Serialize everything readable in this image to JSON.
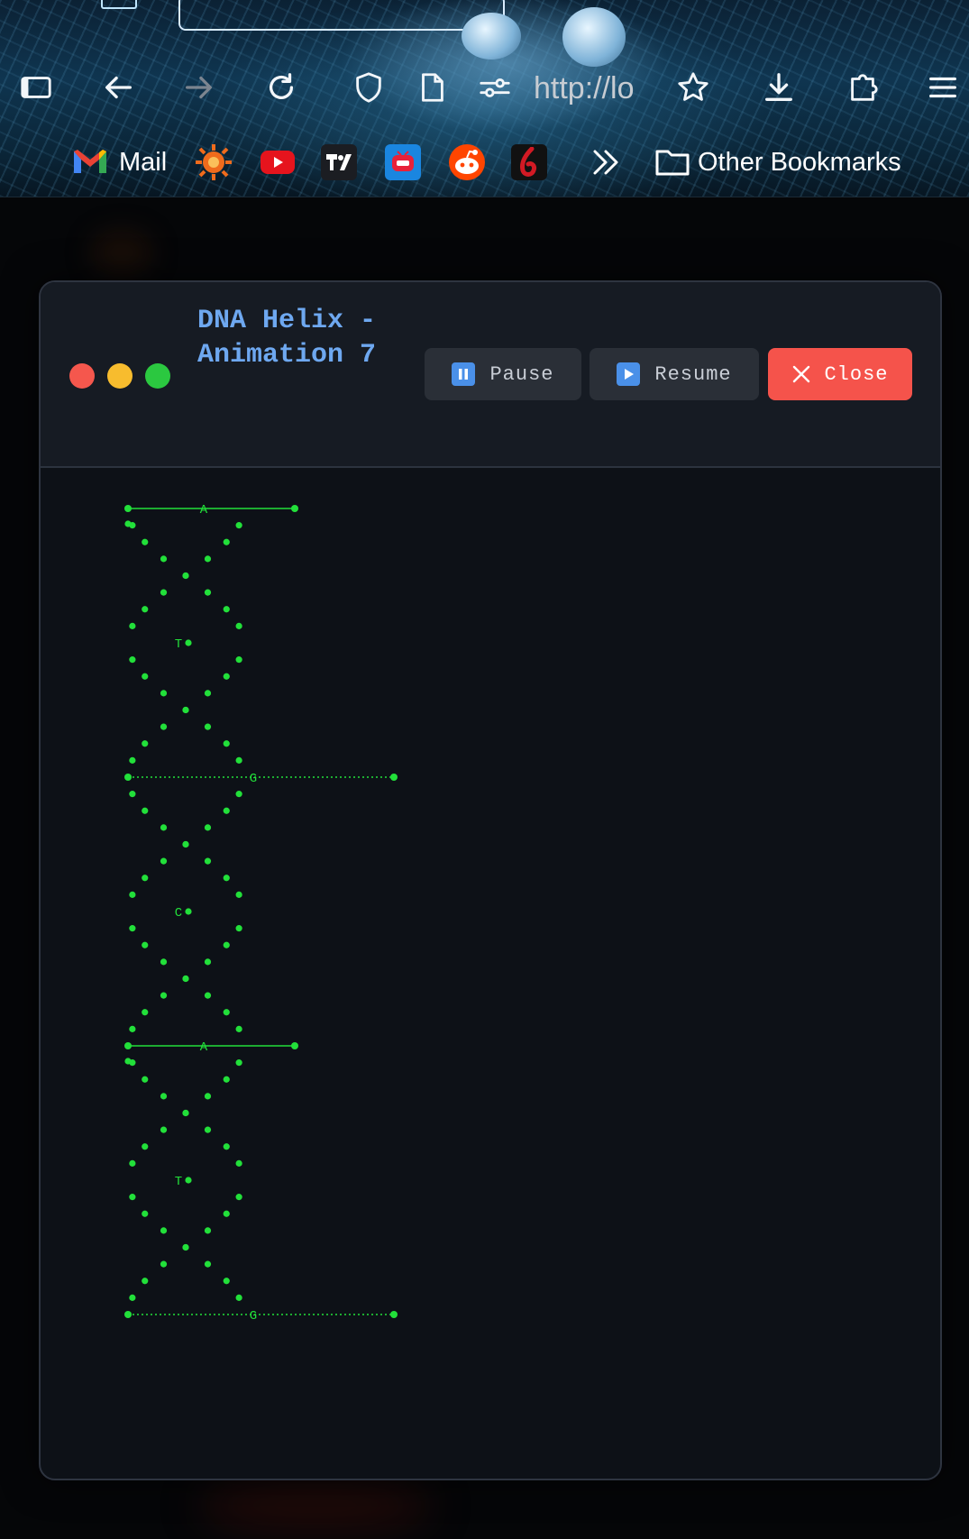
{
  "browser": {
    "url_text": "http://lo",
    "bookmarks": {
      "mail_label": "Mail",
      "other_label": "Other Bookmarks",
      "icons": [
        "gmail-icon",
        "sun-icon",
        "youtube-icon",
        "tradingview-icon",
        "tv-app-icon",
        "reddit-icon",
        "red-app-icon"
      ]
    }
  },
  "window": {
    "title": "DNA Helix - Animation 7",
    "traffic_light_colors": [
      "#f5574d",
      "#f7bc2e",
      "#2bc840"
    ],
    "buttons": {
      "pause_label": "Pause",
      "resume_label": "Resume",
      "close_label": "Close"
    }
  },
  "helix": {
    "color": "#22e03a",
    "base_pairs": [
      {
        "base": "A",
        "line": "solid"
      },
      {
        "base": "T",
        "line": "none"
      },
      {
        "base": "G",
        "line": "dotted"
      },
      {
        "base": "C",
        "line": "none"
      },
      {
        "base": "A",
        "line": "solid"
      },
      {
        "base": "T",
        "line": "none"
      },
      {
        "base": "G",
        "line": "dotted"
      }
    ]
  }
}
